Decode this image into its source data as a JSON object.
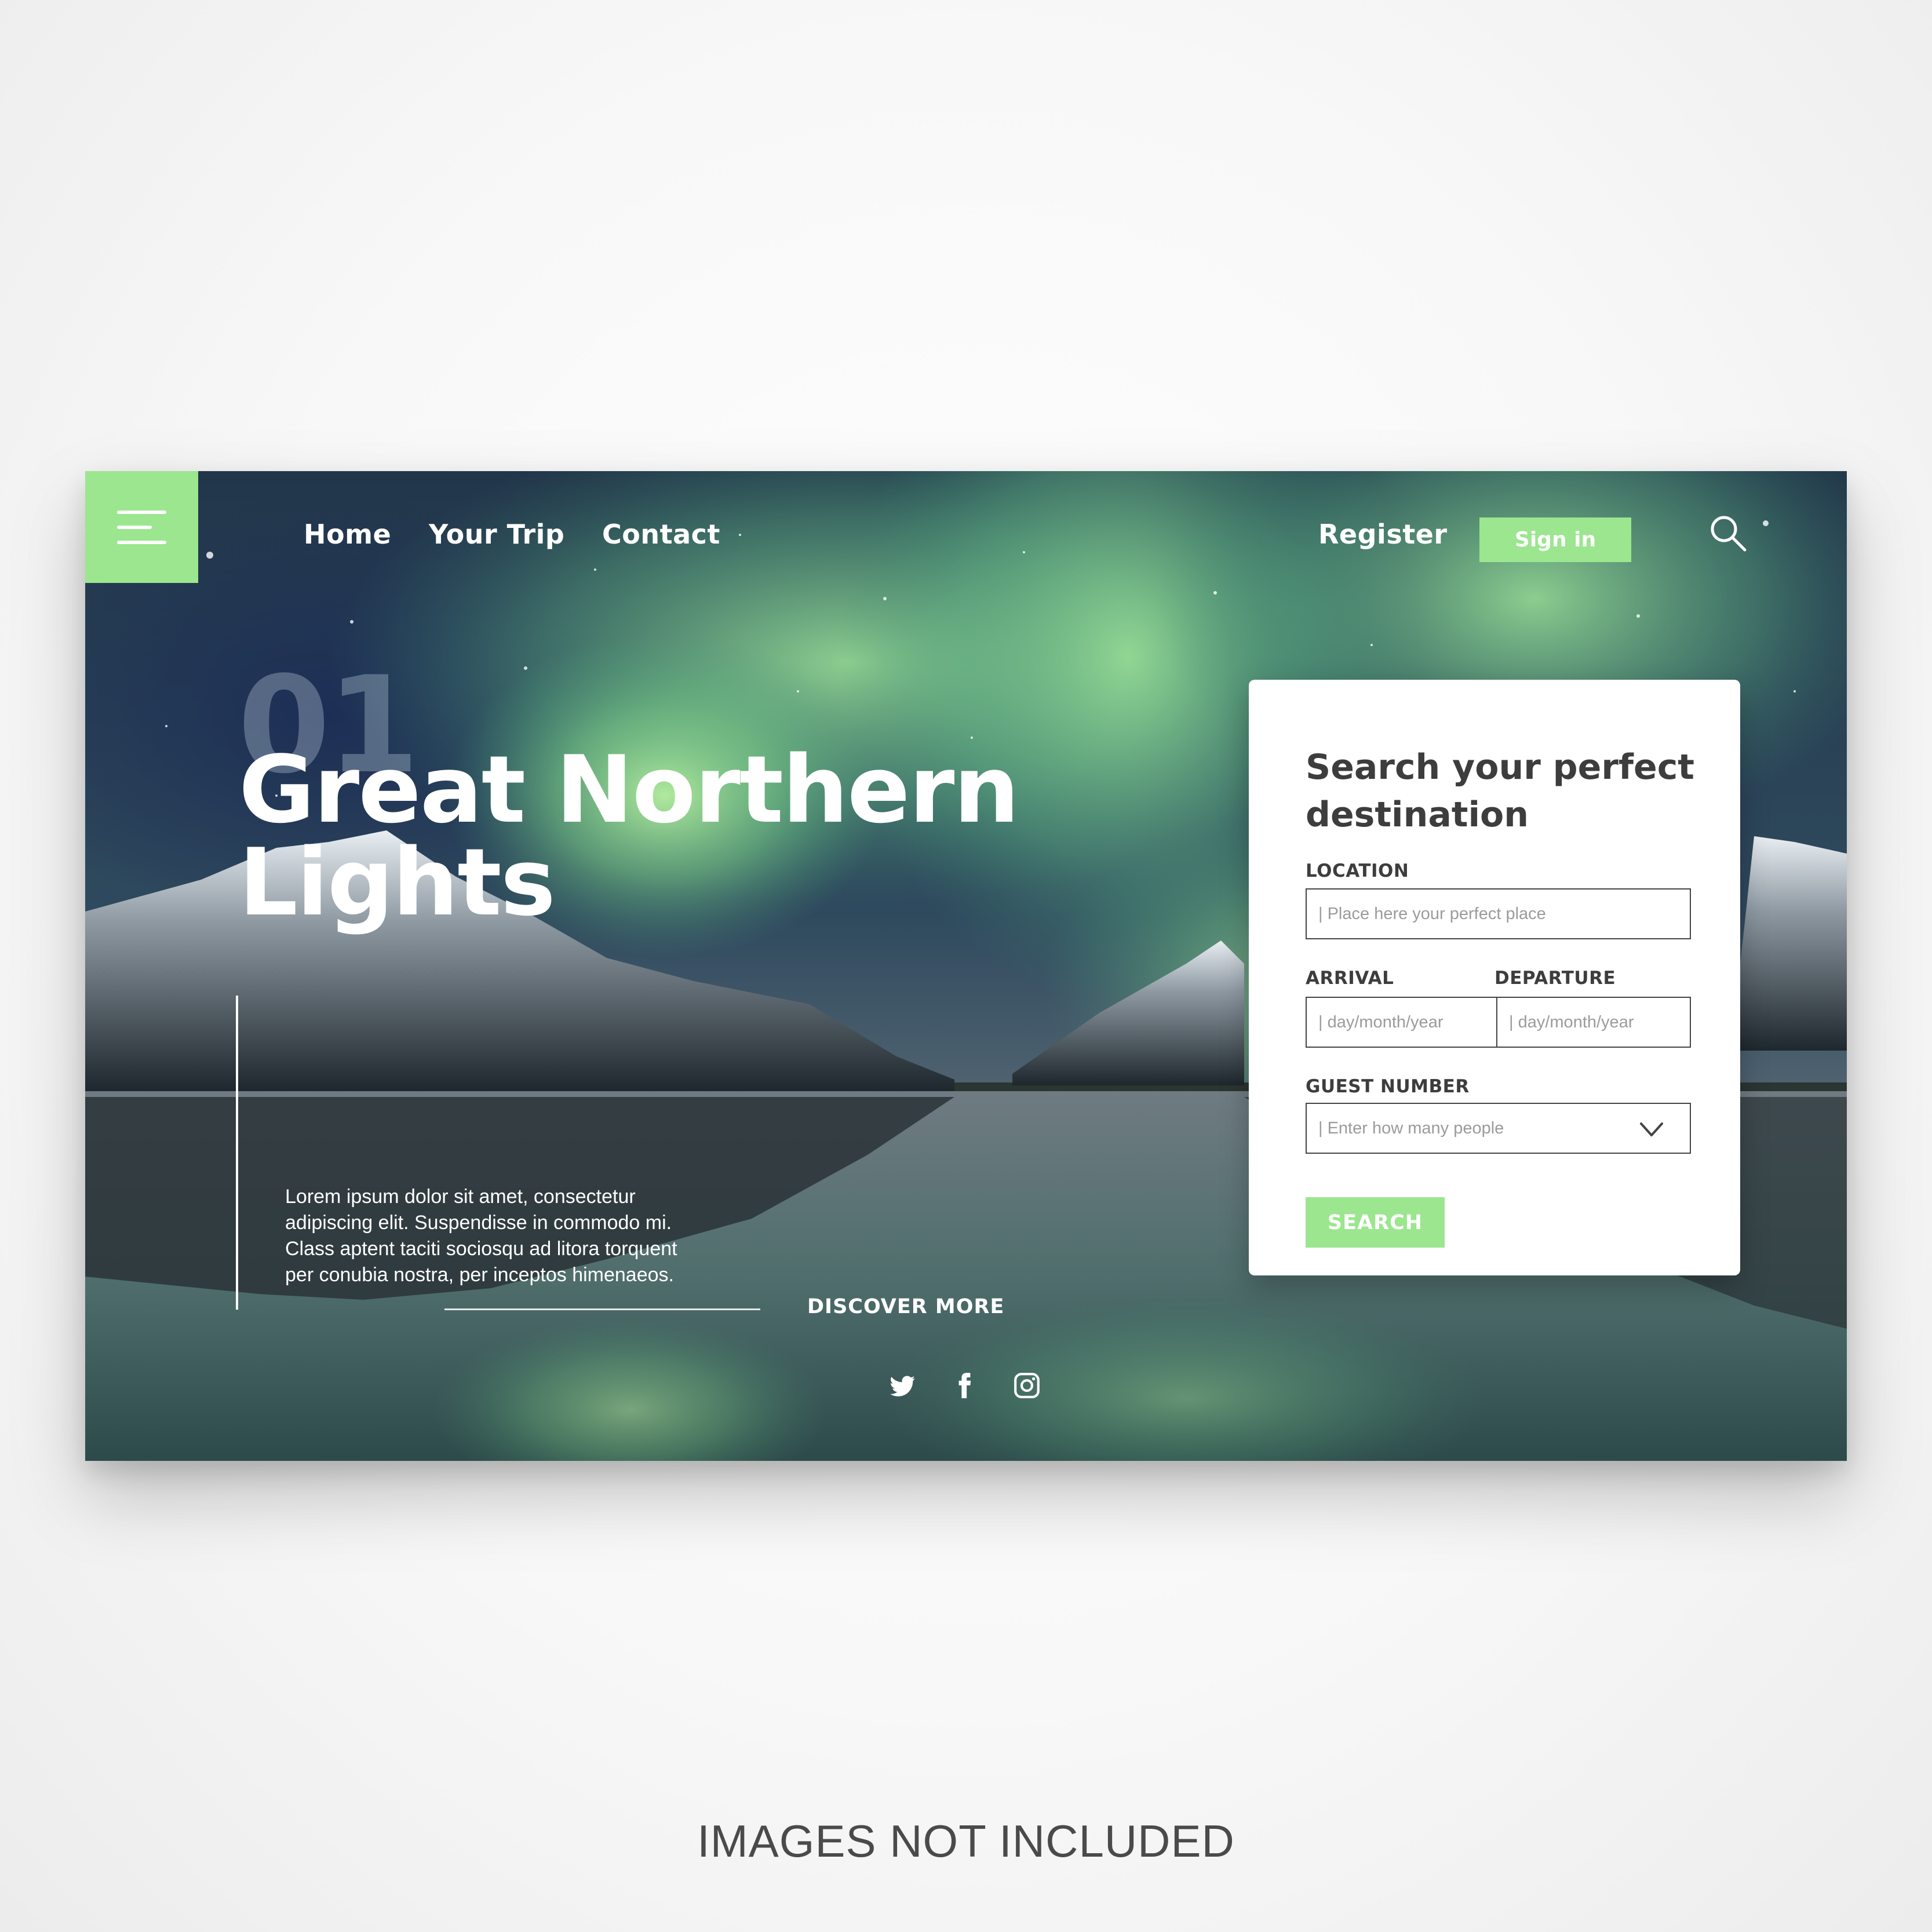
{
  "nav": {
    "links": [
      "Home",
      "Your Trip",
      "Contact"
    ],
    "register_label": "Register",
    "signin_label": "Sign in"
  },
  "hero": {
    "number": "01",
    "title": "Great Northern Lights",
    "description": "Lorem ipsum dolor sit amet, consectetur adipiscing elit. Suspendisse in commodo mi. Class aptent taciti sociosqu ad litora torquent per conubia nostra, per inceptos himenaeos.",
    "discover_label": "DISCOVER MORE"
  },
  "social": [
    "twitter-icon",
    "facebook-icon",
    "instagram-icon"
  ],
  "search_card": {
    "title": "Search your perfect destination",
    "location_label": "LOCATION",
    "location_placeholder": "| Place here your perfect place",
    "arrival_label": "ARRIVAL",
    "arrival_placeholder": "| day/month/year",
    "departure_label": "DEPARTURE",
    "departure_placeholder": "| day/month/year",
    "guests_label": "GUEST NUMBER",
    "guests_placeholder": "| Enter how many people",
    "search_label": "SEARCH"
  },
  "colors": {
    "accent": "#9be68f",
    "card_text": "#3d3d3d",
    "placeholder": "#9b9b9b"
  },
  "footer": {
    "caption": "IMAGES NOT INCLUDED"
  }
}
